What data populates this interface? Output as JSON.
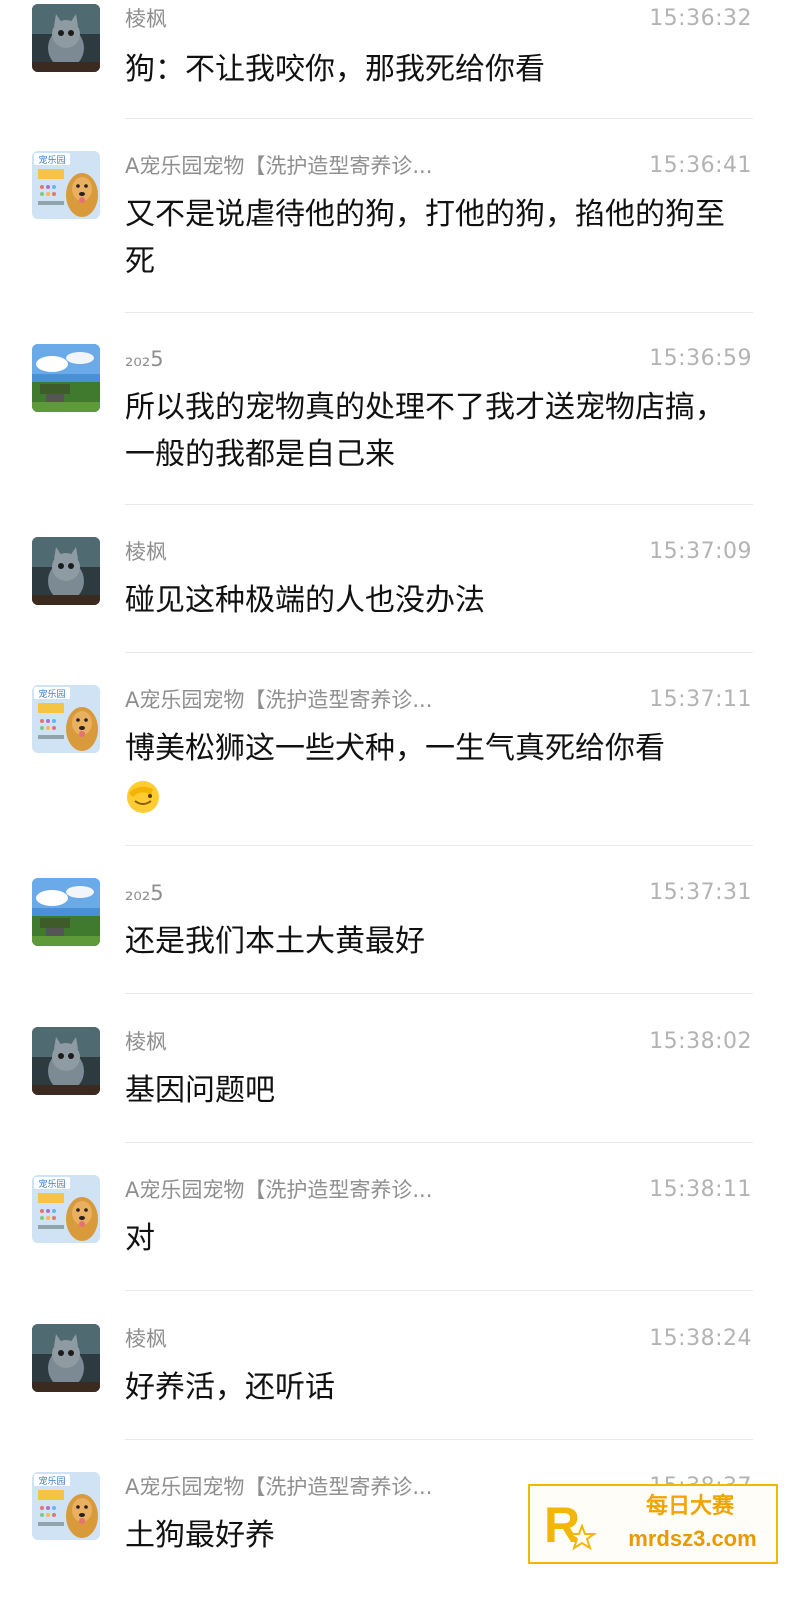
{
  "messages": [
    {
      "sender": "棱枫",
      "time": "15:36:32",
      "text": "狗：不让我咬你，那我死给你看",
      "avatar": "cat-avatar"
    },
    {
      "sender": "A宠乐园宠物【洗护造型寄养诊...",
      "time": "15:36:41",
      "text": "又不是说虐待他的狗，打他的狗，掐他的狗至死",
      "avatar": "pet-shop-avatar"
    },
    {
      "sender": "₂₀₂5",
      "time": "15:36:59",
      "text": "所以我的宠物真的处理不了我才送宠物店搞，一般的我都是自己来",
      "avatar": "landscape-avatar"
    },
    {
      "sender": "棱枫",
      "time": "15:37:09",
      "text": "碰见这种极端的人也没办法",
      "avatar": "cat-avatar"
    },
    {
      "sender": "A宠乐园宠物【洗护造型寄养诊...",
      "time": "15:37:11",
      "text": "博美松狮这一些犬种，一生气真死给你看",
      "emoji": "facepalm-emoji",
      "avatar": "pet-shop-avatar"
    },
    {
      "sender": "₂₀₂5",
      "time": "15:37:31",
      "text": "还是我们本土大黄最好",
      "avatar": "landscape-avatar"
    },
    {
      "sender": "棱枫",
      "time": "15:38:02",
      "text": "基因问题吧",
      "avatar": "cat-avatar"
    },
    {
      "sender": "A宠乐园宠物【洗护造型寄养诊...",
      "time": "15:38:11",
      "text": "对",
      "avatar": "pet-shop-avatar"
    },
    {
      "sender": "棱枫",
      "time": "15:38:24",
      "text": "好养活，还听话",
      "avatar": "cat-avatar"
    },
    {
      "sender": "A宠乐园宠物【洗护造型寄养诊...",
      "time": "15:38:37",
      "text": "土狗最好养",
      "avatar": "pet-shop-avatar"
    }
  ],
  "avatar_badge": "宠乐园",
  "watermark": {
    "title": "每日大赛",
    "url": "mrdsz3.com",
    "logo": "R"
  }
}
